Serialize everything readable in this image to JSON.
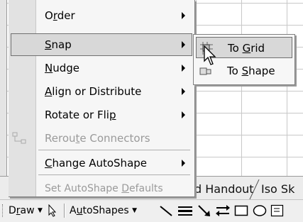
{
  "menu": {
    "items": [
      {
        "label_pre": "O",
        "label_acc": "r",
        "label_post": "der",
        "submenu": true,
        "enabled": true
      },
      {
        "label_pre": "",
        "label_acc": "S",
        "label_post": "nap",
        "submenu": true,
        "enabled": true,
        "highlighted": true
      },
      {
        "label_pre": "",
        "label_acc": "N",
        "label_post": "udge",
        "submenu": true,
        "enabled": true
      },
      {
        "label_pre": "",
        "label_acc": "A",
        "label_post": "lign or Distribute",
        "submenu": true,
        "enabled": true
      },
      {
        "label_pre": "Rotate or Fli",
        "label_acc": "p",
        "label_post": "",
        "submenu": true,
        "enabled": true
      },
      {
        "label_pre": "Rerou",
        "label_acc": "t",
        "label_post": "e Connectors",
        "submenu": false,
        "enabled": false
      },
      {
        "label_pre": "",
        "label_acc": "C",
        "label_post": "hange AutoShape",
        "submenu": true,
        "enabled": true
      },
      {
        "label_pre": "Set AutoShape ",
        "label_acc": "D",
        "label_post": "efaults",
        "submenu": false,
        "enabled": false
      }
    ]
  },
  "submenu": {
    "items": [
      {
        "label_pre": "To ",
        "label_acc": "G",
        "label_post": "rid",
        "icon": "snap-to-grid-icon",
        "highlighted": true
      },
      {
        "label_pre": "To ",
        "label_acc": "S",
        "label_post": "hape",
        "icon": "snap-to-shape-icon"
      }
    ]
  },
  "sheet_tabs": [
    "d Handout",
    "Iso Sk"
  ],
  "toolbar": {
    "draw_pre": "D",
    "draw_acc": "r",
    "draw_post": "aw",
    "autoshapes_pre": "A",
    "autoshapes_acc": "u",
    "autoshapes_post": "toShapes",
    "icons": [
      "select-objects-icon",
      "line-icon",
      "line-style-icon",
      "arrow-icon",
      "arrow-style-icon",
      "rectangle-icon",
      "oval-icon",
      "textbox-icon"
    ]
  },
  "colors": {
    "menu_bg": "#f6f6f6",
    "highlight_bg": "#d8d8d8",
    "disabled_text": "#9a9a9a"
  }
}
